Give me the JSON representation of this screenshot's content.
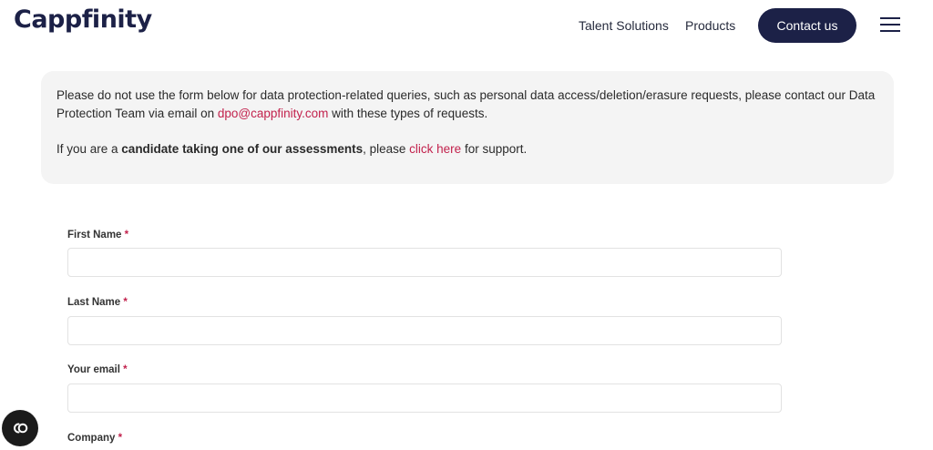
{
  "header": {
    "logo": "Cappfinity",
    "nav": [
      "Talent Solutions",
      "Products"
    ],
    "contact_label": "Contact us",
    "menu_icon": "hamburger-icon"
  },
  "notice": {
    "line1_pre": "Please do not use the form below for data protection-related queries, such as personal data access/deletion/erasure requests, please contact our Data Protection Team via email on ",
    "email": "dpo@cappfinity.com",
    "line1_post": " with these types of requests.",
    "line2_pre": "If you are a ",
    "line2_bold": "candidate taking one of our assessments",
    "line2_mid": ", please ",
    "line2_link": "click here",
    "line2_post": " for support."
  },
  "form": {
    "required_mark": "*",
    "fields": [
      {
        "label": "First Name",
        "value": ""
      },
      {
        "label": "Last Name",
        "value": ""
      },
      {
        "label": "Your email",
        "value": ""
      },
      {
        "label": "Company"
      }
    ]
  },
  "floating_button": {
    "icon": "cookie-preferences-icon"
  },
  "colors": {
    "brand": "#1c2147",
    "accent": "#c2224d",
    "notice_bg": "#f4f4f4"
  }
}
